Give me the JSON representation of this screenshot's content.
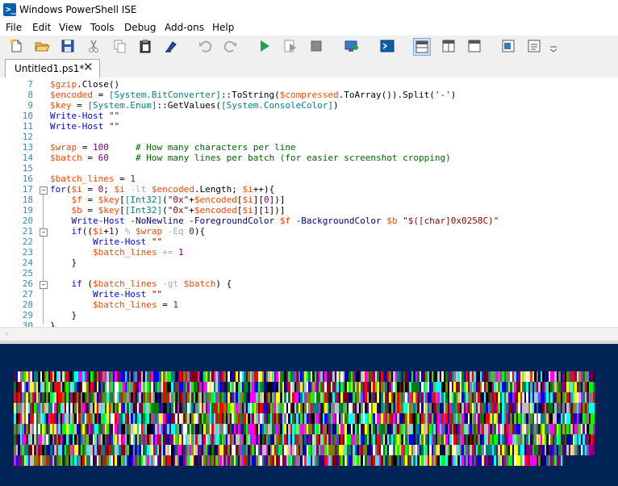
{
  "window": {
    "title": "Windows PowerShell ISE"
  },
  "menu": {
    "items": [
      "File",
      "Edit",
      "View",
      "Tools",
      "Debug",
      "Add-ons",
      "Help"
    ]
  },
  "toolbar": {
    "buttons": [
      "new-script",
      "open-script",
      "save-script",
      "cut",
      "copy",
      "paste",
      "clear-console",
      "undo",
      "redo",
      "run-script",
      "run-selection",
      "stop-operation",
      "new-remote-tab",
      "start-powershell-exe",
      "show-script-pane-top",
      "show-script-pane-right",
      "show-script-pane-maximized",
      "show-script-pane",
      "show-command-window",
      "show-command-addon"
    ]
  },
  "tabs": [
    {
      "label": "Untitled1.ps1*",
      "close": "✕"
    }
  ],
  "editor": {
    "lines": [
      {
        "n": "7",
        "tokens": [
          [
            "var",
            "$gzip"
          ],
          [
            "mem",
            ".Close()"
          ]
        ]
      },
      {
        "n": "8",
        "tokens": [
          [
            "var",
            "$encoded"
          ],
          [
            "mem",
            " = "
          ],
          [
            "type",
            "[System.BitConverter]"
          ],
          [
            "mem",
            "::ToString("
          ],
          [
            "var",
            "$compressed"
          ],
          [
            "mem",
            ".ToArray()).Split("
          ],
          [
            "str",
            "'-'"
          ],
          [
            "mem",
            ")"
          ]
        ]
      },
      {
        "n": "9",
        "tokens": [
          [
            "var",
            "$key"
          ],
          [
            "mem",
            " = "
          ],
          [
            "type",
            "[System.Enum]"
          ],
          [
            "mem",
            "::GetValues("
          ],
          [
            "type",
            "[System.ConsoleColor]"
          ],
          [
            "mem",
            ")"
          ]
        ]
      },
      {
        "n": "10",
        "tokens": [
          [
            "cmd",
            "Write-Host"
          ],
          [
            "mem",
            " "
          ],
          [
            "str",
            "\"\""
          ]
        ]
      },
      {
        "n": "11",
        "tokens": [
          [
            "cmd",
            "Write-Host"
          ],
          [
            "mem",
            " "
          ],
          [
            "str",
            "\"\""
          ]
        ]
      },
      {
        "n": "12",
        "tokens": []
      },
      {
        "n": "13",
        "tokens": [
          [
            "var",
            "$wrap"
          ],
          [
            "mem",
            " = "
          ],
          [
            "num",
            "100"
          ],
          [
            "mem",
            "     "
          ],
          [
            "cmt",
            "# How many characters per line"
          ]
        ]
      },
      {
        "n": "14",
        "tokens": [
          [
            "var",
            "$batch"
          ],
          [
            "mem",
            " = "
          ],
          [
            "num",
            "60"
          ],
          [
            "mem",
            "     "
          ],
          [
            "cmt",
            "# How many lines per batch (for easier screenshot cropping)"
          ]
        ]
      },
      {
        "n": "15",
        "tokens": []
      },
      {
        "n": "16",
        "tokens": [
          [
            "var",
            "$batch_lines"
          ],
          [
            "mem",
            " = "
          ],
          [
            "num",
            "1"
          ]
        ]
      },
      {
        "n": "17",
        "tokens": [
          [
            "cmd",
            "for"
          ],
          [
            "mem",
            "("
          ],
          [
            "var",
            "$i"
          ],
          [
            "mem",
            " = "
          ],
          [
            "num",
            "0"
          ],
          [
            "mem",
            "; "
          ],
          [
            "var",
            "$i"
          ],
          [
            "mem",
            " "
          ],
          [
            "op",
            "-lt"
          ],
          [
            "mem",
            " "
          ],
          [
            "var",
            "$encoded"
          ],
          [
            "mem",
            ".Length; "
          ],
          [
            "var",
            "$i"
          ],
          [
            "mem",
            "++){"
          ]
        ]
      },
      {
        "n": "18",
        "tokens": [
          [
            "mem",
            "    "
          ],
          [
            "var",
            "$f"
          ],
          [
            "mem",
            " = "
          ],
          [
            "var",
            "$key"
          ],
          [
            "mem",
            "["
          ],
          [
            "type",
            "[Int32]"
          ],
          [
            "mem",
            "("
          ],
          [
            "str",
            "\"0x\""
          ],
          [
            "mem",
            "+"
          ],
          [
            "var",
            "$encoded"
          ],
          [
            "mem",
            "["
          ],
          [
            "var",
            "$i"
          ],
          [
            "mem",
            "]["
          ],
          [
            "num",
            "0"
          ],
          [
            "mem",
            "])]"
          ]
        ]
      },
      {
        "n": "19",
        "tokens": [
          [
            "mem",
            "    "
          ],
          [
            "var",
            "$b"
          ],
          [
            "mem",
            " = "
          ],
          [
            "var",
            "$key"
          ],
          [
            "mem",
            "["
          ],
          [
            "type",
            "[Int32]"
          ],
          [
            "mem",
            "("
          ],
          [
            "str",
            "\"0x\""
          ],
          [
            "mem",
            "+"
          ],
          [
            "var",
            "$encoded"
          ],
          [
            "mem",
            "["
          ],
          [
            "var",
            "$i"
          ],
          [
            "mem",
            "]["
          ],
          [
            "num",
            "1"
          ],
          [
            "mem",
            "])]"
          ]
        ]
      },
      {
        "n": "20",
        "tokens": [
          [
            "mem",
            "    "
          ],
          [
            "cmd",
            "Write-Host"
          ],
          [
            "mem",
            " "
          ],
          [
            "prm",
            "-NoNewline"
          ],
          [
            "mem",
            " "
          ],
          [
            "prm",
            "-ForegroundColor"
          ],
          [
            "mem",
            " "
          ],
          [
            "var",
            "$f"
          ],
          [
            "mem",
            " "
          ],
          [
            "prm",
            "-BackgroundColor"
          ],
          [
            "mem",
            " "
          ],
          [
            "var",
            "$b"
          ],
          [
            "mem",
            " "
          ],
          [
            "str",
            "\"$([char]0x0258C)\""
          ]
        ]
      },
      {
        "n": "21",
        "tokens": [
          [
            "mem",
            "    "
          ],
          [
            "cmd",
            "if"
          ],
          [
            "mem",
            "(("
          ],
          [
            "var",
            "$i"
          ],
          [
            "mem",
            "+"
          ],
          [
            "num",
            "1"
          ],
          [
            "mem",
            ") "
          ],
          [
            "op",
            "%"
          ],
          [
            "mem",
            " "
          ],
          [
            "var",
            "$wrap"
          ],
          [
            "mem",
            " "
          ],
          [
            "op",
            "-Eq"
          ],
          [
            "mem",
            " "
          ],
          [
            "num",
            "0"
          ],
          [
            "mem",
            "){"
          ]
        ]
      },
      {
        "n": "22",
        "tokens": [
          [
            "mem",
            "        "
          ],
          [
            "cmd",
            "Write-Host"
          ],
          [
            "mem",
            " "
          ],
          [
            "str",
            "\"\""
          ]
        ]
      },
      {
        "n": "23",
        "tokens": [
          [
            "mem",
            "        "
          ],
          [
            "var",
            "$batch_lines"
          ],
          [
            "mem",
            " "
          ],
          [
            "op",
            "+="
          ],
          [
            "mem",
            " "
          ],
          [
            "num",
            "1"
          ]
        ]
      },
      {
        "n": "24",
        "tokens": [
          [
            "mem",
            "    }"
          ]
        ]
      },
      {
        "n": "25",
        "tokens": []
      },
      {
        "n": "26",
        "tokens": [
          [
            "mem",
            "    "
          ],
          [
            "cmd",
            "if"
          ],
          [
            "mem",
            " ("
          ],
          [
            "var",
            "$batch_lines"
          ],
          [
            "mem",
            " "
          ],
          [
            "op",
            "-gt"
          ],
          [
            "mem",
            " "
          ],
          [
            "var",
            "$batch"
          ],
          [
            "mem",
            ") {"
          ]
        ]
      },
      {
        "n": "27",
        "tokens": [
          [
            "mem",
            "        "
          ],
          [
            "cmd",
            "Write-Host"
          ],
          [
            "mem",
            " "
          ],
          [
            "str",
            "\"\""
          ]
        ]
      },
      {
        "n": "28",
        "tokens": [
          [
            "mem",
            "        "
          ],
          [
            "var",
            "$batch_lines"
          ],
          [
            "mem",
            " = "
          ],
          [
            "num",
            "1"
          ]
        ]
      },
      {
        "n": "29",
        "tokens": [
          [
            "mem",
            "    }"
          ]
        ]
      },
      {
        "n": "30",
        "tokens": [
          [
            "mem",
            "}"
          ]
        ]
      }
    ]
  },
  "colors": {
    "console_bg": "#012456",
    "palette": [
      "#000000",
      "#000080",
      "#008000",
      "#008080",
      "#800000",
      "#800080",
      "#808000",
      "#c0c0c0",
      "#808080",
      "#0000ff",
      "#00ff00",
      "#00ffff",
      "#ff0000",
      "#ff00ff",
      "#ffff00",
      "#ffffff"
    ]
  }
}
